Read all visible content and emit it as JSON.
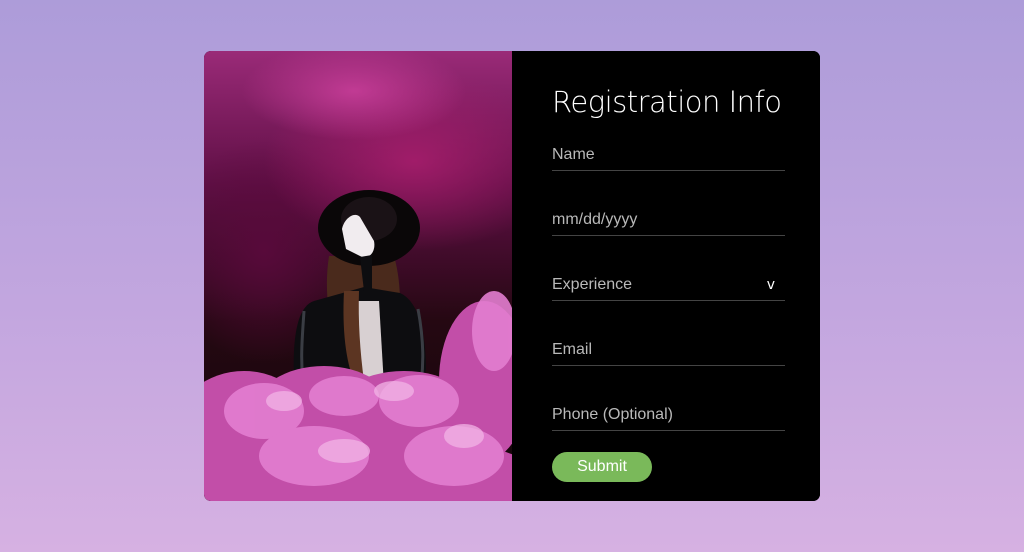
{
  "form": {
    "title": "Registration Info",
    "name_placeholder": "Name",
    "date_placeholder": "mm/dd/yyyy",
    "experience_label": "Experience",
    "experience_chevron": "v",
    "email_placeholder": "Email",
    "phone_placeholder": "Phone (Optional)",
    "submit_label": "Submit"
  },
  "colors": {
    "background_top": "#ad9cd9",
    "background_bottom": "#d6b1e2",
    "panel": "#000000",
    "submit_button": "#7ab95a",
    "placeholder_text": "#b9b9b9"
  },
  "image": {
    "subject": "person in black hat and leather jacket surrounded by pink smoke"
  }
}
